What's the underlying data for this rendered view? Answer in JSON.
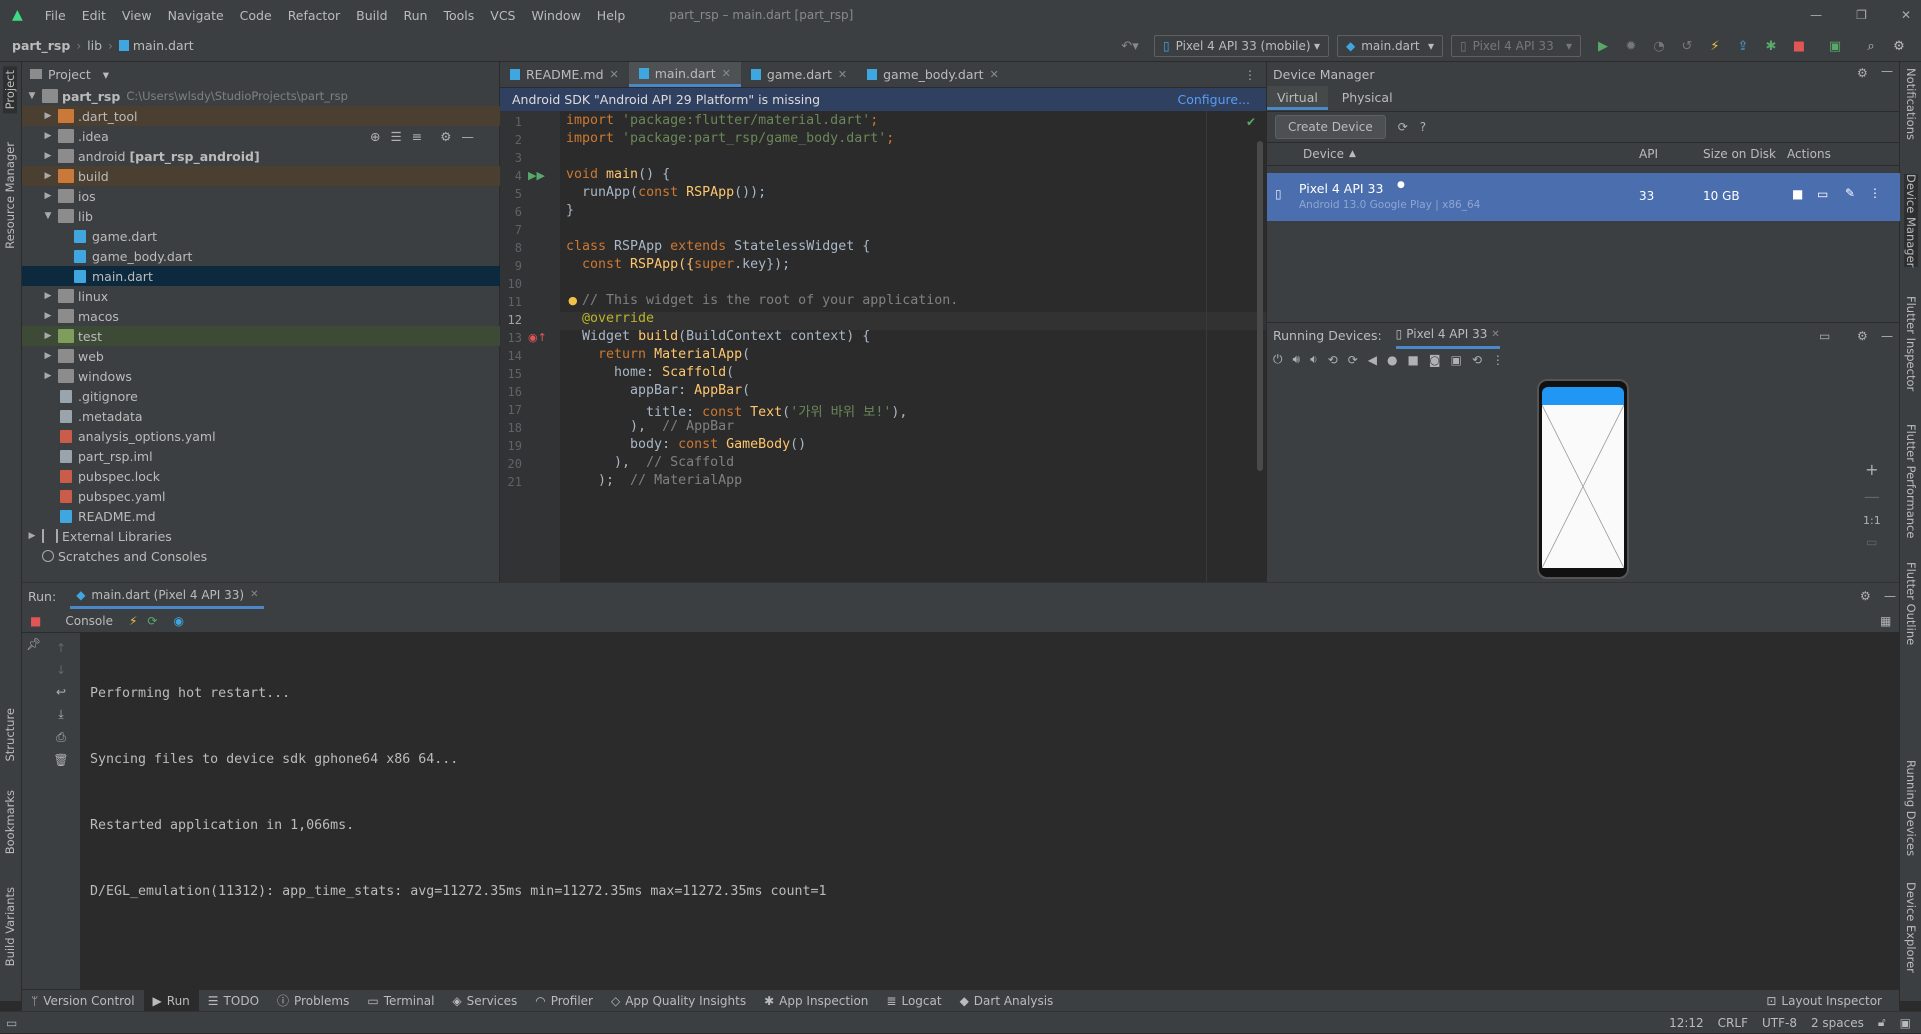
{
  "window": {
    "title": "part_rsp – main.dart [part_rsp]"
  },
  "menu": [
    "File",
    "Edit",
    "View",
    "Navigate",
    "Code",
    "Refactor",
    "Build",
    "Run",
    "Tools",
    "VCS",
    "Window",
    "Help"
  ],
  "breadcrumb": [
    "part_rsp",
    "lib",
    "main.dart"
  ],
  "toolbar": {
    "device_combo": "Pixel 4 API 33 (mobile)",
    "config_combo": "main.dart",
    "run_device_combo": "Pixel 4 API 33"
  },
  "left_stripe": {
    "project": "Project",
    "resource_manager": "Resource Manager",
    "structure": "Structure",
    "bookmarks": "Bookmarks",
    "build_variants": "Build Variants"
  },
  "right_stripe": {
    "notifications": "Notifications",
    "device_manager": "Device Manager",
    "flutter_inspector": "Flutter Inspector",
    "flutter_performance": "Flutter Performance",
    "flutter_outline": "Flutter Outline",
    "running_devices": "Running Devices",
    "device_explorer": "Device Explorer"
  },
  "project": {
    "header": "Project",
    "root_name": "part_rsp",
    "root_path": "C:\\Users\\wlsdy\\StudioProjects\\part_rsp",
    "items": [
      {
        "label": ".dart_tool",
        "extra": ""
      },
      {
        "label": ".idea",
        "extra": ""
      },
      {
        "label": "android",
        "extra": "[part_rsp_android]"
      },
      {
        "label": "build",
        "extra": ""
      },
      {
        "label": "ios",
        "extra": ""
      },
      {
        "label": "lib",
        "extra": ""
      },
      {
        "label": "game.dart",
        "extra": ""
      },
      {
        "label": "game_body.dart",
        "extra": ""
      },
      {
        "label": "main.dart",
        "extra": ""
      },
      {
        "label": "linux",
        "extra": ""
      },
      {
        "label": "macos",
        "extra": ""
      },
      {
        "label": "test",
        "extra": ""
      },
      {
        "label": "web",
        "extra": ""
      },
      {
        "label": "windows",
        "extra": ""
      },
      {
        "label": ".gitignore",
        "extra": ""
      },
      {
        "label": ".metadata",
        "extra": ""
      },
      {
        "label": "analysis_options.yaml",
        "extra": ""
      },
      {
        "label": "part_rsp.iml",
        "extra": ""
      },
      {
        "label": "pubspec.lock",
        "extra": ""
      },
      {
        "label": "pubspec.yaml",
        "extra": ""
      },
      {
        "label": "README.md",
        "extra": ""
      },
      {
        "label": "External Libraries",
        "extra": ""
      },
      {
        "label": "Scratches and Consoles",
        "extra": ""
      }
    ]
  },
  "editor": {
    "tabs": [
      "README.md",
      "main.dart",
      "game.dart",
      "game_body.dart"
    ],
    "active_tab": "main.dart",
    "banner": "Android SDK \"Android API 29 Platform\" is missing",
    "banner_action": "Configure...",
    "lines": [
      "1",
      "2",
      "3",
      "4",
      "5",
      "6",
      "7",
      "8",
      "9",
      "10",
      "11",
      "12",
      "13",
      "14",
      "15",
      "16",
      "17",
      "18",
      "19",
      "20",
      "21"
    ],
    "code": {
      "l1a": "import ",
      "l1b": "'package:flutter/material.dart'",
      "l1c": ";",
      "l2a": "import ",
      "l2b": "'package:part_rsp/game_body.dart'",
      "l2c": ";",
      "l4a": "void ",
      "l4b": "main",
      "l4c": "() {",
      "l5a": "  runApp(",
      "l5b": "const ",
      "l5c": "RSPApp",
      "l5d": "());",
      "l6": "}",
      "l8a": "class ",
      "l8b": "RSPApp ",
      "l8c": "extends ",
      "l8d": "StatelessWidget {",
      "l9a": "  const ",
      "l9b": "RSPApp({",
      "l9c": "super",
      "l9d": ".key});",
      "l11": "  // This widget is the root of your application.",
      "l12": "  @override",
      "l13a": "  Widget ",
      "l13b": "build",
      "l13c": "(BuildContext context) {",
      "l14a": "    return ",
      "l14b": "MaterialApp",
      "l14c": "(",
      "l15a": "      home: ",
      "l15b": "Scaffold",
      "l15c": "(",
      "l16a": "        appBar: ",
      "l16b": "AppBar",
      "l16c": "(",
      "l17a": "          title: ",
      "l17b": "const ",
      "l17c": "Text",
      "l17d": "(",
      "l17e": "'가위 바위 보!'",
      "l17f": "),",
      "l18a": "        ),  ",
      "l18b": "// AppBar",
      "l19a": "        body: ",
      "l19b": "const ",
      "l19c": "GameBody",
      "l19d": "()",
      "l20a": "      ),  ",
      "l20b": "// Scaffold",
      "l21a": "    );  ",
      "l21b": "// MaterialApp"
    }
  },
  "device_manager": {
    "title": "Device Manager",
    "tabs": [
      "Virtual",
      "Physical"
    ],
    "create_button": "Create Device",
    "columns": [
      "Device",
      "API",
      "Size on Disk",
      "Actions"
    ],
    "device": {
      "name": "Pixel 4 API 33",
      "sub": "Android 13.0 Google Play | x86_64",
      "api": "33",
      "size": "10 GB"
    },
    "running_label": "Running Devices:",
    "running_tab": "Pixel 4 API 33",
    "zoom_label": "1:1"
  },
  "run": {
    "label": "Run:",
    "config_tab": "main.dart (Pixel 4 API 33)",
    "console_tab": "Console",
    "output": [
      "Performing hot restart...",
      "Syncing files to device sdk gphone64 x86 64...",
      "Restarted application in 1,066ms.",
      "D/EGL_emulation(11312): app_time_stats: avg=11272.35ms min=11272.35ms max=11272.35ms count=1"
    ]
  },
  "bottom_tabs": [
    "Version Control",
    "Run",
    "TODO",
    "Problems",
    "Terminal",
    "Services",
    "Profiler",
    "App Quality Insights",
    "App Inspection",
    "Logcat",
    "Dart Analysis"
  ],
  "layout_inspector": "Layout Inspector",
  "status": {
    "position": "12:12",
    "line_sep": "CRLF",
    "encoding": "UTF-8",
    "indent": "2 spaces"
  },
  "colors": {
    "accent": "#4a88c7",
    "selection": "#0d293e",
    "device_row": "#4b6eaf",
    "banner": "#304060"
  }
}
